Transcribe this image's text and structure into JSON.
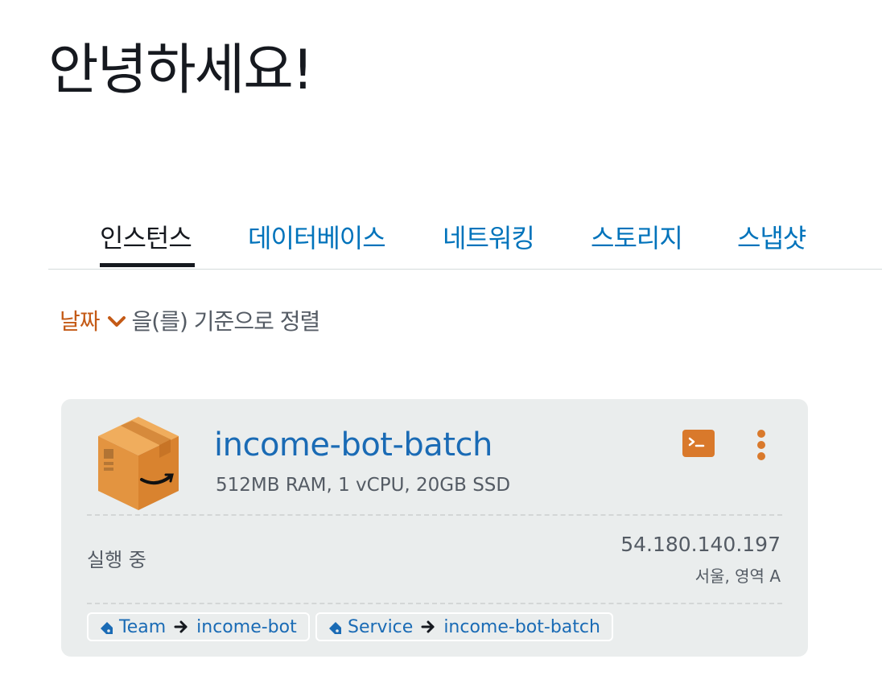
{
  "greeting": "안녕하세요!",
  "tabs": [
    {
      "label": "인스턴스",
      "active": true
    },
    {
      "label": "데이터베이스",
      "active": false
    },
    {
      "label": "네트워킹",
      "active": false
    },
    {
      "label": "스토리지",
      "active": false
    },
    {
      "label": "스냅샷",
      "active": false
    }
  ],
  "sort": {
    "key": "날짜",
    "suffix": "을(를) 기준으로 정렬",
    "icon": "chevron-down-icon"
  },
  "instance": {
    "name": "income-bot-batch",
    "spec": "512MB RAM, 1 vCPU, 20GB SSD",
    "status": "실행 중",
    "ip": "54.180.140.197",
    "region": "서울, 영역 A",
    "tags": [
      {
        "key": "Team",
        "value": "income-bot"
      },
      {
        "key": "Service",
        "value": "income-bot-batch"
      }
    ]
  },
  "colors": {
    "link": "#0073bb",
    "accent_orange": "#d9792b",
    "sort_key": "#c45a16",
    "card_bg": "#eaeded",
    "text_dark": "#16191f",
    "text_muted": "#545b64"
  }
}
